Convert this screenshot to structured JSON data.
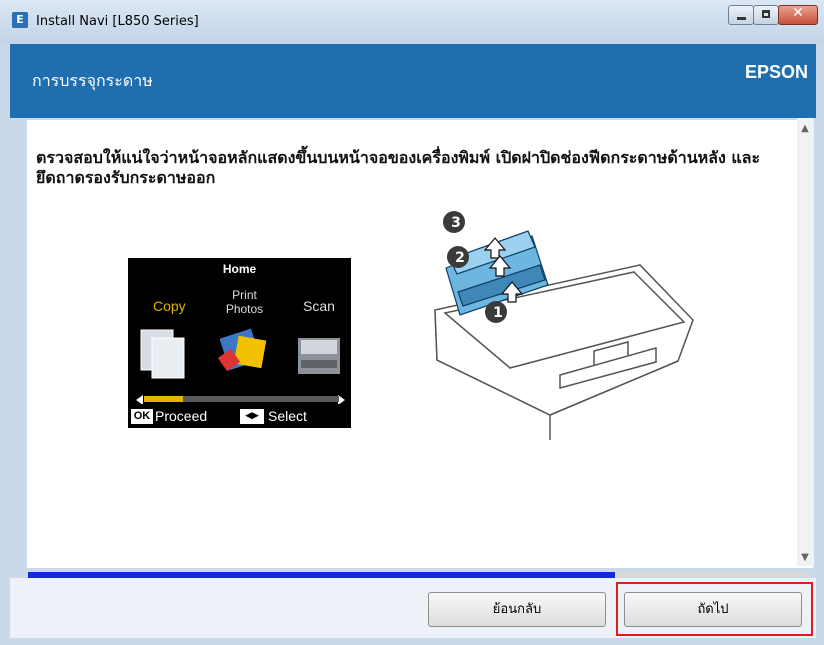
{
  "window": {
    "title": "Install Navi [L850 Series]",
    "buttons": [
      "minimize",
      "maximize",
      "close"
    ],
    "icon": "app-icon"
  },
  "header": {
    "title": "การบรรจุกระดาษ",
    "brand": "EPSON"
  },
  "main": {
    "instruction": "ตรวจสอบให้แน่ใจว่าหน้าจอหลักแสดงขึ้นบนหน้าจอของเครื่องพิมพ์ เปิดฝาปิดช่องฟีดกระดาษด้านหลัง และยึดถาดรองรับกระดาษออก",
    "lcd": {
      "home": "Home",
      "copy": "Copy",
      "print": "Print",
      "photos": "Photos",
      "scan": "Scan",
      "ok": "OK",
      "proceed": "Proceed",
      "select": "Select"
    },
    "steps": [
      "1",
      "2",
      "3"
    ]
  },
  "progress": {
    "percent": 75
  },
  "footer": {
    "back_label": "ย้อนกลับ",
    "next_label": "ถัดไป"
  },
  "colors": {
    "header_bg": "#1f6fb0",
    "progress": "#1528d6",
    "highlight": "#e21b1b"
  }
}
